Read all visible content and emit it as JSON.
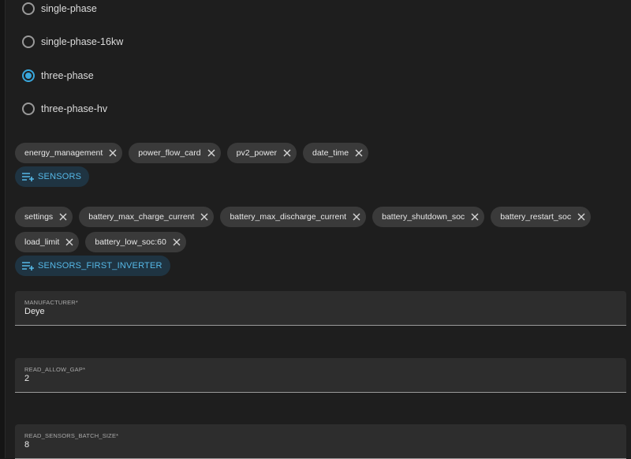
{
  "inverter_options": [
    {
      "label": "single-phase",
      "checked": false
    },
    {
      "label": "single-phase-16kw",
      "checked": false
    },
    {
      "label": "three-phase",
      "checked": true
    },
    {
      "label": "three-phase-hv",
      "checked": false
    }
  ],
  "sensors": {
    "chips": [
      "energy_management",
      "power_flow_card",
      "pv2_power",
      "date_time"
    ],
    "add_label": "SENSORS"
  },
  "sensors_first_inverter": {
    "chips": [
      "settings",
      "battery_max_charge_current",
      "battery_max_discharge_current",
      "battery_shutdown_soc",
      "battery_restart_soc",
      "load_limit",
      "battery_low_soc:60"
    ],
    "add_label": "SENSORS_FIRST_INVERTER"
  },
  "fields": [
    {
      "label": "MANUFACTURER*",
      "value": "Deye"
    },
    {
      "label": "READ_ALLOW_GAP*",
      "value": "2"
    },
    {
      "label": "READ_SENSORS_BATCH_SIZE*",
      "value": "8"
    }
  ],
  "colors": {
    "accent": "#39a7dc",
    "chip_bg": "#3a3a3a",
    "field_bg": "#2d2d2d"
  }
}
